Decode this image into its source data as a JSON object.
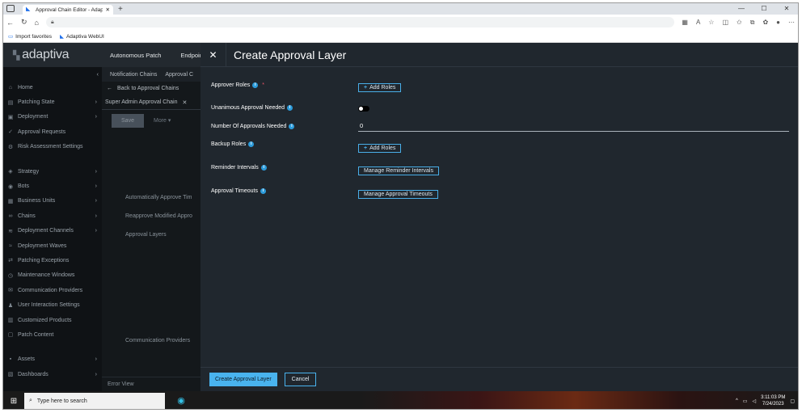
{
  "browser": {
    "tab_title": "Approval Chain Editor - Adaptiv",
    "tab_close": "✕",
    "new_tab": "+",
    "address_placeholder": "",
    "favorites": [
      {
        "label": "Import favorites"
      },
      {
        "label": "Adaptiva WebUI"
      }
    ],
    "window_buttons": [
      "—",
      "☐",
      "✕"
    ]
  },
  "app": {
    "logo": "adaptiva",
    "top_tabs": [
      "Autonomous Patch",
      "Endpoint"
    ],
    "sub_tabs": [
      "Notification Chains",
      "Approval C"
    ],
    "back_link": "Back to Approval Chains",
    "chain_tab": "Super Admin Approval Chain",
    "save_label": "Save",
    "more_label": "More ▾",
    "background_fields": [
      "Automatically Approve Tim",
      "Reapprove Modified Appro",
      "Approval Layers",
      "Communication Providers"
    ],
    "error_view": "Error View"
  },
  "sidebar": {
    "items": [
      {
        "label": "Home",
        "icon": "home-icon",
        "glyph": "⌂",
        "chev": false
      },
      {
        "label": "Patching State",
        "icon": "chart-icon",
        "glyph": "▤",
        "chev": true
      },
      {
        "label": "Deployment",
        "icon": "box-icon",
        "glyph": "▣",
        "chev": true
      },
      {
        "label": "Approval Requests",
        "icon": "check-icon",
        "glyph": "✓",
        "chev": false
      },
      {
        "label": "Risk Assessment Settings",
        "icon": "gear-icon",
        "glyph": "⚙",
        "chev": false
      },
      {
        "label": "Strategy",
        "icon": "strategy-icon",
        "glyph": "◈",
        "chev": true
      },
      {
        "label": "Bots",
        "icon": "bot-icon",
        "glyph": "◉",
        "chev": true
      },
      {
        "label": "Business Units",
        "icon": "building-icon",
        "glyph": "▦",
        "chev": true
      },
      {
        "label": "Chains",
        "icon": "chain-icon",
        "glyph": "∞",
        "chev": true
      },
      {
        "label": "Deployment Channels",
        "icon": "channel-icon",
        "glyph": "≋",
        "chev": true
      },
      {
        "label": "Deployment Waves",
        "icon": "wave-icon",
        "glyph": "≈",
        "chev": false
      },
      {
        "label": "Patching Exceptions",
        "icon": "exception-icon",
        "glyph": "⇄",
        "chev": false
      },
      {
        "label": "Maintenance Windows",
        "icon": "clock-icon",
        "glyph": "◷",
        "chev": false
      },
      {
        "label": "Communication Providers",
        "icon": "chat-icon",
        "glyph": "✉",
        "chev": false
      },
      {
        "label": "User Interaction Settings",
        "icon": "users-icon",
        "glyph": "♟",
        "chev": false
      },
      {
        "label": "Customized Products",
        "icon": "product-icon",
        "glyph": "▥",
        "chev": false
      },
      {
        "label": "Patch Content",
        "icon": "file-icon",
        "glyph": "▢",
        "chev": false
      },
      {
        "label": "Assets",
        "icon": "assets-icon",
        "glyph": "▪",
        "chev": true
      },
      {
        "label": "Dashboards",
        "icon": "dashboard-icon",
        "glyph": "▧",
        "chev": true
      }
    ]
  },
  "panel": {
    "title": "Create Approval Layer",
    "fields": {
      "approver_roles": {
        "label": "Approver Roles",
        "required": "*",
        "button": "Add Roles"
      },
      "unanimous": {
        "label": "Unanimous Approval Needed",
        "value": "off"
      },
      "num_approvals": {
        "label": "Number Of Approvals Needed",
        "value": "0"
      },
      "backup_roles": {
        "label": "Backup Roles",
        "button": "Add Roles"
      },
      "reminder": {
        "label": "Reminder Intervals",
        "button": "Manage Reminder Intervals"
      },
      "timeouts": {
        "label": "Approval Timeouts",
        "button": "Manage Approval Timeouts"
      }
    },
    "create_label": "Create Approval Layer",
    "cancel_label": "Cancel"
  },
  "taskbar": {
    "search_placeholder": "Type here to search",
    "time": "3:11:03 PM",
    "date": "7/24/2023"
  }
}
